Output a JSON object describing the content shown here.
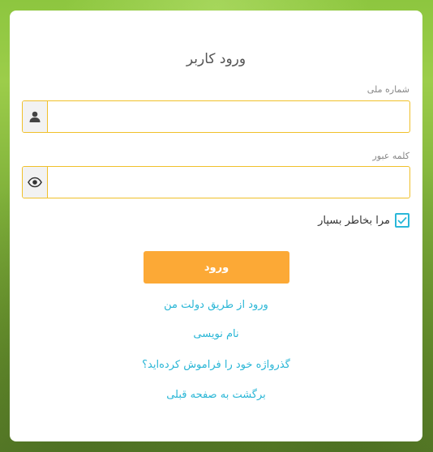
{
  "login": {
    "title": "ورود کاربر",
    "national_id": {
      "label": "شماره ملی",
      "value": "",
      "placeholder": ""
    },
    "password": {
      "label": "کلمه عبور",
      "value": "",
      "placeholder": ""
    },
    "remember_me": {
      "label": "مرا بخاطر بسپار",
      "checked": true
    },
    "submit_label": "ورود",
    "links": {
      "dolat_man": "ورود از طریق دولت من",
      "register": "نام نویسی",
      "forgot_password": "گذرواژه خود را فراموش کرده‌اید؟",
      "back": "برگشت به صفحه قبلی"
    }
  },
  "colors": {
    "accent_button": "#fca936",
    "link": "#29b6d6",
    "field_border": "#f0c02a"
  },
  "icons": {
    "national_id_addon": "user-icon",
    "password_addon": "eye-icon",
    "remember_checkbox": "checkmark-icon"
  }
}
